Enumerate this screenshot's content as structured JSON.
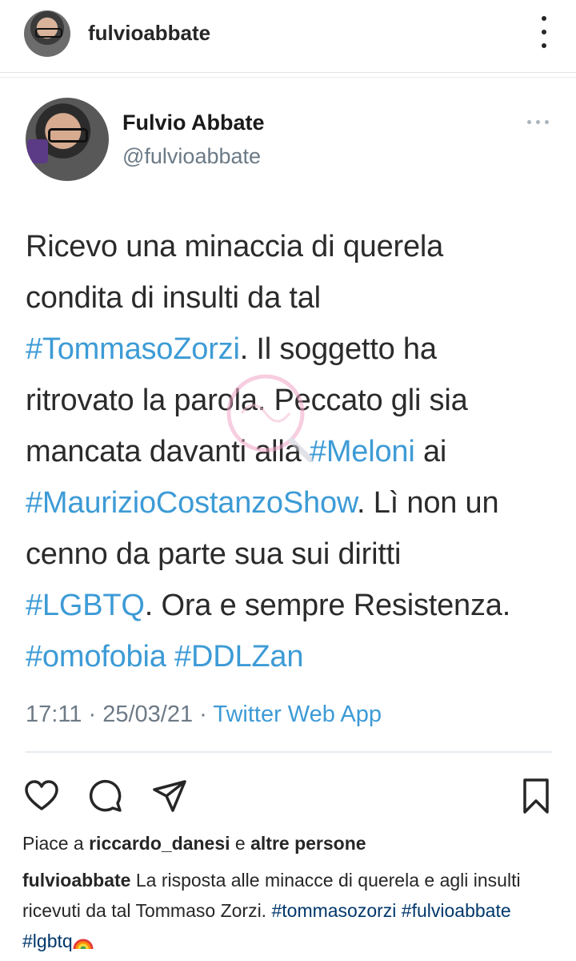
{
  "post": {
    "username": "fulvioabbate"
  },
  "tweet": {
    "name": "Fulvio Abbate",
    "handle": "@fulvioabbate",
    "lines": [
      [
        {
          "t": "Ricevo una minaccia di querela",
          "tag": false
        }
      ],
      [
        {
          "t": "condita di insulti da tal",
          "tag": false
        }
      ],
      [
        {
          "t": "#TommasoZorzi",
          "tag": true
        },
        {
          "t": ". Il soggetto ha",
          "tag": false
        }
      ],
      [
        {
          "t": "ritrovato la parola. Peccato gli sia",
          "tag": false
        }
      ],
      [
        {
          "t": "mancata davanti alla ",
          "tag": false
        },
        {
          "t": "#Meloni",
          "tag": true
        },
        {
          "t": " ai",
          "tag": false
        }
      ],
      [
        {
          "t": "#MaurizioCostanzoShow",
          "tag": true
        },
        {
          "t": ". Lì non un",
          "tag": false
        }
      ],
      [
        {
          "t": "cenno da parte sua sui diritti",
          "tag": false
        }
      ],
      [
        {
          "t": "#LGBTQ",
          "tag": true
        },
        {
          "t": ". Ora e sempre Resistenza.",
          "tag": false
        }
      ],
      [
        {
          "t": "#omofobia",
          "tag": true
        },
        {
          "t": " ",
          "tag": false
        },
        {
          "t": "#DDLZan",
          "tag": true
        }
      ]
    ],
    "meta_time": "17:11 · 25/03/21 · ",
    "meta_app": "Twitter Web App"
  },
  "likes": {
    "prefix": "Piace a ",
    "user": "riccardo_danesi",
    "middle": " e ",
    "suffix": "altre persone"
  },
  "caption": {
    "user": "fulvioabbate",
    "text": " La risposta alle minacce di querela e agli insulti ricevuti da tal Tommaso Zorzi. ",
    "tag1": "#tommasozorzi",
    "tag2": "#fulvioabbate",
    "tag3": "#lgbtq"
  },
  "icons": {
    "like": "heart-icon",
    "comment": "comment-icon",
    "share": "send-icon",
    "save": "bookmark-icon",
    "more": "more-icon"
  },
  "colors": {
    "hashtag": "#3d9bd6",
    "caption_tag": "#00376b",
    "muted": "#6d7a86"
  }
}
